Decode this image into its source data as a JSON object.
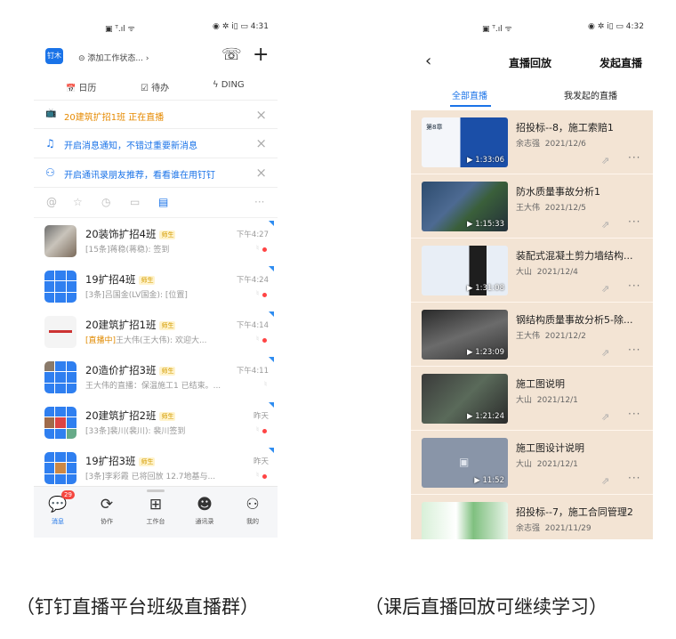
{
  "left_phone": {
    "status_bar": {
      "left": "▣ ᵀ.ıl ᯤ",
      "right": "◉ ✲ ⅰ▯ ▭ 4:31"
    },
    "header": {
      "avatar": "钉木",
      "work_status": "⊝ 添加工作状态... ›",
      "icon_phone": "☏",
      "icon_add": "+"
    },
    "quick_bar": [
      {
        "icon": "📅",
        "label": "日历"
      },
      {
        "icon": "☑",
        "label": "待办"
      },
      {
        "icon": "ϟ",
        "label": "DING"
      }
    ],
    "notices": [
      {
        "icon": "📺",
        "text": "20建筑扩招1班 正在直播",
        "color": "#e68a00"
      },
      {
        "icon": "🔔",
        "text": "开启消息通知，不错过重要新消息",
        "color": "#1a73e8"
      },
      {
        "icon": "👤",
        "text": "开启通讯录朋友推荐，看看谁在用钉钉",
        "color": "#1a73e8"
      }
    ],
    "filter_icons": [
      "@",
      "☆",
      "◷",
      "▭",
      "▤",
      "···"
    ],
    "chats": [
      {
        "name": "20装饰扩招4班",
        "tag": "师生",
        "preview": "[15条]蒋稳(蒋稳): 签到",
        "time": "下午4:27"
      },
      {
        "name": "19扩招4班",
        "tag": "师生",
        "preview": "[3条]吕国金(LV国金): [位置]",
        "time": "下午4:24"
      },
      {
        "name": "20建筑扩招1班",
        "tag": "师生",
        "live": "[直播中]",
        "preview": "王大伟(王大伟): 欢迎大...",
        "time": "下午4:14"
      },
      {
        "name": "20造价扩招3班",
        "tag": "师生",
        "preview": "王大伟的直播：保温施工1 已结束。...",
        "time": "下午4:11"
      },
      {
        "name": "20建筑扩招2班",
        "tag": "师生",
        "preview": "[33条]裴川(裴川): 裴川签到",
        "time": "昨天"
      },
      {
        "name": "19扩招3班",
        "tag": "师生",
        "preview": "[3条]李彩霞 已将回放 12.7地基与...",
        "time": "昨天"
      }
    ],
    "tabbar": [
      {
        "icon": "💬",
        "label": "消息",
        "badge": "29"
      },
      {
        "icon": "⟳",
        "label": "协作"
      },
      {
        "icon": "⊞",
        "label": "工作台"
      },
      {
        "icon": "☻",
        "label": "通讯录"
      },
      {
        "icon": "⚇",
        "label": "我的"
      }
    ]
  },
  "right_phone": {
    "status_bar": {
      "left": "▣ ᵀ.ıl ᯤ",
      "right": "◉ ✲ ⅰ▯ ▭ 4:32"
    },
    "back": "‹",
    "title": "直播回放",
    "action": "发起直播",
    "tabs": [
      "全部直播",
      "我发起的直播"
    ],
    "videos": [
      {
        "title": "招投标--8，施工索赔1",
        "author": "余志强",
        "date": "2021/12/6",
        "duration": "▶ 1:33:06",
        "thumb_text": "第8章"
      },
      {
        "title": "防水质量事故分析1",
        "author": "王大伟",
        "date": "2021/12/5",
        "duration": "▶ 1:15:33",
        "thumb_text": ""
      },
      {
        "title": "装配式混凝土剪力墙结构...",
        "author": "大山",
        "date": "2021/12/4",
        "duration": "▶ 1:31:08",
        "thumb_text": ""
      },
      {
        "title": "钢结构质量事故分析5-除...",
        "author": "王大伟",
        "date": "2021/12/2",
        "duration": "▶ 1:23:09",
        "thumb_text": ""
      },
      {
        "title": "施工图说明",
        "author": "大山",
        "date": "2021/12/1",
        "duration": "▶ 1:21:24",
        "thumb_text": ""
      },
      {
        "title": "施工图设计说明",
        "author": "大山",
        "date": "2021/12/1",
        "duration": "▶ 11:52",
        "thumb_text": ""
      },
      {
        "title": "招投标--7，施工合同管理2",
        "author": "余志强",
        "date": "2021/11/29",
        "duration": "",
        "thumb_text": ""
      }
    ],
    "share_icon": "⇗",
    "more_icon": "···"
  },
  "captions": {
    "left": "（钉钉直播平台班级直播群）",
    "right": "（课后直播回放可继续学习）"
  }
}
